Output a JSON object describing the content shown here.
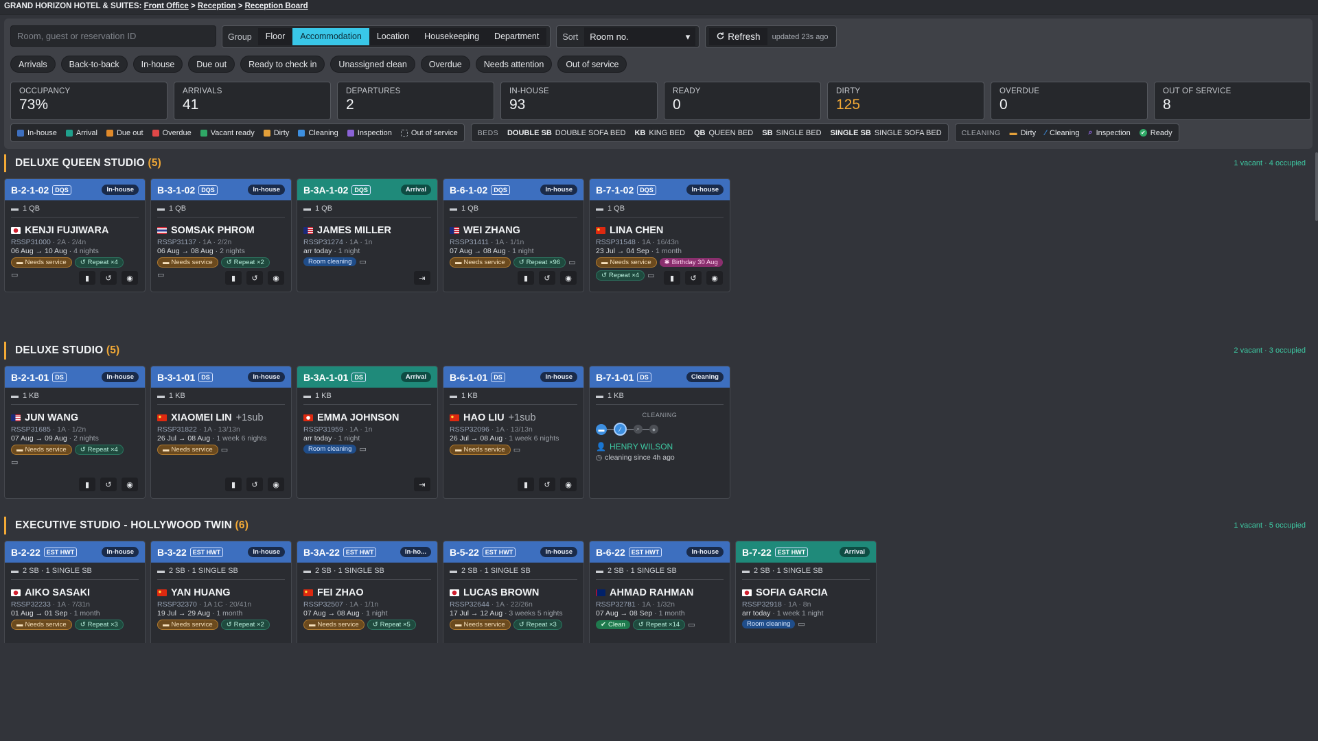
{
  "breadcrumb": {
    "hotel": "GRAND HORIZON HOTEL & SUITES:",
    "front": "Front Office",
    "reception": "Reception",
    "board": "Reception Board",
    "sep": ">"
  },
  "toolbar": {
    "search_placeholder": "Room, guest or reservation ID",
    "group_label": "Group",
    "group_options": [
      "Floor",
      "Accommodation",
      "Location",
      "Housekeeping",
      "Department"
    ],
    "group_active": "Accommodation",
    "sort_label": "Sort",
    "sort_value": "Room no.",
    "refresh_label": "Refresh",
    "updated": "updated 23s ago"
  },
  "filters": [
    "Arrivals",
    "Back-to-back",
    "In-house",
    "Due out",
    "Ready to check in",
    "Unassigned clean",
    "Overdue",
    "Needs attention",
    "Out of service"
  ],
  "stats": [
    {
      "title": "OCCUPANCY",
      "value": "73%",
      "warn": false
    },
    {
      "title": "ARRIVALS",
      "value": "41",
      "warn": false
    },
    {
      "title": "DEPARTURES",
      "value": "2",
      "warn": false
    },
    {
      "title": "IN-HOUSE",
      "value": "93",
      "warn": false
    },
    {
      "title": "READY",
      "value": "0",
      "warn": false
    },
    {
      "title": "DIRTY",
      "value": "125",
      "warn": true
    },
    {
      "title": "OVERDUE",
      "value": "0",
      "warn": false
    },
    {
      "title": "OUT OF SERVICE",
      "value": "8",
      "warn": false
    }
  ],
  "legend_status": [
    {
      "label": "In-house",
      "color": "#3d6fbf"
    },
    {
      "label": "Arrival",
      "color": "#1fa08c"
    },
    {
      "label": "Due out",
      "color": "#e08a2a"
    },
    {
      "label": "Overdue",
      "color": "#e04848"
    },
    {
      "label": "Vacant ready",
      "color": "#2fa866"
    },
    {
      "label": "Dirty",
      "color": "#e3a03a"
    },
    {
      "label": "Cleaning",
      "color": "#3d8fe0"
    },
    {
      "label": "Inspection",
      "color": "#8a62d6"
    },
    {
      "label": "Out of service",
      "color": ""
    }
  ],
  "legend_beds": {
    "caption": "BEDS",
    "items": [
      {
        "code": "DOUBLE SB",
        "label": "DOUBLE SOFA BED"
      },
      {
        "code": "KB",
        "label": "KING BED"
      },
      {
        "code": "QB",
        "label": "QUEEN BED"
      },
      {
        "code": "SB",
        "label": "SINGLE BED"
      },
      {
        "code": "SINGLE SB",
        "label": "SINGLE SOFA BED"
      }
    ]
  },
  "legend_cleaning": {
    "caption": "CLEANING",
    "items": [
      {
        "label": "Dirty",
        "icon": "bed-icon",
        "color": "#e3a03a"
      },
      {
        "label": "Cleaning",
        "icon": "broom-icon",
        "color": "#3d8fe0"
      },
      {
        "label": "Inspection",
        "icon": "magnifier-icon",
        "color": "#8a62d6"
      },
      {
        "label": "Ready",
        "icon": "check-circle-icon",
        "color": "#2fa866"
      }
    ]
  },
  "sections": [
    {
      "title": "DELUXE QUEEN STUDIO",
      "count": "(5)",
      "meta": "1 vacant · 4 occupied",
      "cards": [
        {
          "room": "B-2-1-02",
          "code": "DQS",
          "status": "In-house",
          "kind": "in",
          "bed": "1 QB",
          "guest": "KENJI FUJIWARA",
          "sub": "",
          "flag": "jp",
          "res": "RSSP31000",
          "occ": "2A · 2/4n",
          "dates": "06 Aug → 10 Aug",
          "dur": "· 4 nights",
          "tags": [
            {
              "t": "Needs service",
              "k": "service"
            },
            {
              "t": "Repeat ×4",
              "k": "repeat"
            }
          ],
          "note_row": true,
          "actions": [
            "clipboard",
            "history",
            "eye"
          ]
        },
        {
          "room": "B-3-1-02",
          "code": "DQS",
          "status": "In-house",
          "kind": "in",
          "bed": "1 QB",
          "guest": "SOMSAK PHROM",
          "sub": "",
          "flag": "th",
          "res": "RSSP31137",
          "occ": "1A · 2/2n",
          "dates": "06 Aug → 08 Aug",
          "dur": "· 2 nights",
          "tags": [
            {
              "t": "Needs service",
              "k": "service"
            },
            {
              "t": "Repeat ×2",
              "k": "repeat"
            }
          ],
          "note_row": true,
          "actions": [
            "clipboard",
            "history",
            "eye"
          ]
        },
        {
          "room": "B-3A-1-02",
          "code": "DQS",
          "status": "Arrival",
          "kind": "arr",
          "bed": "1 QB",
          "guest": "JAMES MILLER",
          "sub": "",
          "flag": "my",
          "res": "RSSP31274",
          "occ": "1A · 1n",
          "dates": "arr today",
          "dur": "· 1 night",
          "tags": [
            {
              "t": "Room cleaning",
              "k": "clean-rm"
            }
          ],
          "note_inline": true,
          "actions": [
            "login"
          ]
        },
        {
          "room": "B-6-1-02",
          "code": "DQS",
          "status": "In-house",
          "kind": "in",
          "bed": "1 QB",
          "guest": "WEI ZHANG",
          "sub": "",
          "flag": "my",
          "res": "RSSP31411",
          "occ": "1A · 1/1n",
          "dates": "07 Aug → 08 Aug",
          "dur": "· 1 night",
          "tags": [
            {
              "t": "Needs service",
              "k": "service"
            },
            {
              "t": "Repeat ×96",
              "k": "repeat"
            }
          ],
          "note_inline": true,
          "actions": [
            "clipboard",
            "history",
            "eye"
          ]
        },
        {
          "room": "B-7-1-02",
          "code": "DQS",
          "status": "In-house",
          "kind": "in",
          "bed": "1 QB",
          "guest": "LINA CHEN",
          "sub": "",
          "flag": "cn",
          "res": "RSSP31548",
          "occ": "1A · 16/43n",
          "dates": "23 Jul → 04 Sep",
          "dur": "· 1 month",
          "tags": [
            {
              "t": "Needs service",
              "k": "service"
            },
            {
              "t": "Birthday 30 Aug",
              "k": "birthday"
            },
            {
              "t": "Repeat ×4",
              "k": "repeat"
            }
          ],
          "note_inline": true,
          "actions": [
            "clipboard",
            "history",
            "eye"
          ]
        }
      ]
    },
    {
      "title": "DELUXE STUDIO",
      "count": "(5)",
      "meta": "2 vacant · 3 occupied",
      "cards": [
        {
          "room": "B-2-1-01",
          "code": "DS",
          "status": "In-house",
          "kind": "in",
          "bed": "1 KB",
          "guest": "JUN WANG",
          "sub": "",
          "flag": "my",
          "res": "RSSP31685",
          "occ": "1A · 1/2n",
          "dates": "07 Aug → 09 Aug",
          "dur": "· 2 nights",
          "tags": [
            {
              "t": "Needs service",
              "k": "service"
            },
            {
              "t": "Repeat ×4",
              "k": "repeat"
            }
          ],
          "note_row": true,
          "actions": [
            "clipboard",
            "history",
            "eye"
          ]
        },
        {
          "room": "B-3-1-01",
          "code": "DS",
          "status": "In-house",
          "kind": "in",
          "bed": "1 KB",
          "guest": "XIAOMEI LIN",
          "sub": "+1sub",
          "flag": "cn",
          "res": "RSSP31822",
          "occ": "1A · 13/13n",
          "dates": "26 Jul → 08 Aug",
          "dur": "· 1 week 6 nights",
          "tags": [
            {
              "t": "Needs service",
              "k": "service"
            }
          ],
          "note_inline": true,
          "actions": [
            "clipboard",
            "history",
            "eye"
          ]
        },
        {
          "room": "B-3A-1-01",
          "code": "DS",
          "status": "Arrival",
          "kind": "arr",
          "bed": "1 KB",
          "guest": "EMMA JOHNSON",
          "sub": "",
          "flag": "hk",
          "res": "RSSP31959",
          "occ": "1A · 1n",
          "dates": "arr today",
          "dur": "· 1 night",
          "tags": [
            {
              "t": "Room cleaning",
              "k": "clean-rm"
            }
          ],
          "note_inline": true,
          "actions": [
            "login"
          ]
        },
        {
          "room": "B-6-1-01",
          "code": "DS",
          "status": "In-house",
          "kind": "in",
          "bed": "1 KB",
          "guest": "HAO LIU",
          "sub": "+1sub",
          "flag": "cn",
          "res": "RSSP32096",
          "occ": "1A · 13/13n",
          "dates": "26 Jul → 08 Aug",
          "dur": "· 1 week 6 nights",
          "tags": [
            {
              "t": "Needs service",
              "k": "service"
            }
          ],
          "note_inline": true,
          "actions": [
            "clipboard",
            "history",
            "eye"
          ]
        },
        {
          "room": "B-7-1-01",
          "code": "DS",
          "status": "Cleaning",
          "kind": "clean",
          "bed": "1 KB",
          "cleaning": {
            "label": "CLEANING",
            "cleaner": "HENRY WILSON",
            "since": "cleaning since 4h ago"
          }
        }
      ]
    },
    {
      "title": "EXECUTIVE STUDIO - HOLLYWOOD TWIN",
      "count": "(6)",
      "meta": "1 vacant · 5 occupied",
      "cards": [
        {
          "room": "B-2-22",
          "code": "EST HWT",
          "status": "In-house",
          "kind": "in",
          "bed": "2 SB · 1 SINGLE SB",
          "guest": "AIKO SASAKI",
          "sub": "",
          "flag": "jp",
          "res": "RSSP32233",
          "occ": "1A · 7/31n",
          "dates": "01 Aug → 01 Sep",
          "dur": "· 1 month",
          "tags": [
            {
              "t": "Needs service",
              "k": "service"
            },
            {
              "t": "Repeat ×3",
              "k": "repeat"
            }
          ]
        },
        {
          "room": "B-3-22",
          "code": "EST HWT",
          "status": "In-house",
          "kind": "in",
          "bed": "2 SB · 1 SINGLE SB",
          "guest": "YAN HUANG",
          "sub": "",
          "flag": "cn",
          "res": "RSSP32370",
          "occ": "1A 1C · 20/41n",
          "dates": "19 Jul → 29 Aug",
          "dur": "· 1 month",
          "tags": [
            {
              "t": "Needs service",
              "k": "service"
            },
            {
              "t": "Repeat ×2",
              "k": "repeat"
            }
          ]
        },
        {
          "room": "B-3A-22",
          "code": "EST HWT",
          "status": "In-ho...",
          "kind": "in",
          "bed": "2 SB · 1 SINGLE SB",
          "guest": "FEI ZHAO",
          "sub": "",
          "flag": "cn",
          "res": "RSSP32507",
          "occ": "1A · 1/1n",
          "dates": "07 Aug → 08 Aug",
          "dur": "· 1 night",
          "tags": [
            {
              "t": "Needs service",
              "k": "service"
            },
            {
              "t": "Repeat ×5",
              "k": "repeat"
            }
          ]
        },
        {
          "room": "B-5-22",
          "code": "EST HWT",
          "status": "In-house",
          "kind": "in",
          "bed": "2 SB · 1 SINGLE SB",
          "guest": "LUCAS BROWN",
          "sub": "",
          "flag": "jp",
          "res": "RSSP32644",
          "occ": "1A · 22/26n",
          "dates": "17 Jul → 12 Aug",
          "dur": "· 3 weeks 5 nights",
          "tags": [
            {
              "t": "Needs service",
              "k": "service"
            },
            {
              "t": "Repeat ×3",
              "k": "repeat"
            }
          ]
        },
        {
          "room": "B-6-22",
          "code": "EST HWT",
          "status": "In-house",
          "kind": "in",
          "bed": "2 SB · 1 SINGLE SB",
          "guest": "AHMAD RAHMAN",
          "sub": "",
          "flag": "au",
          "res": "RSSP32781",
          "occ": "1A · 1/32n",
          "dates": "07 Aug → 08 Sep",
          "dur": "· 1 month",
          "tags": [
            {
              "t": "Clean",
              "k": "clean-ok"
            },
            {
              "t": "Repeat ×14",
              "k": "repeat"
            }
          ],
          "note_inline": true
        },
        {
          "room": "B-7-22",
          "code": "EST HWT",
          "status": "Arrival",
          "kind": "arr",
          "bed": "2 SB · 1 SINGLE SB",
          "guest": "SOFIA GARCIA",
          "sub": "",
          "flag": "jp",
          "res": "RSSP32918",
          "occ": "1A · 8n",
          "dates": "arr today",
          "dur": "· 1 week 1 night",
          "tags": [
            {
              "t": "Room cleaning",
              "k": "clean-rm"
            }
          ],
          "note_inline": true
        }
      ]
    }
  ]
}
